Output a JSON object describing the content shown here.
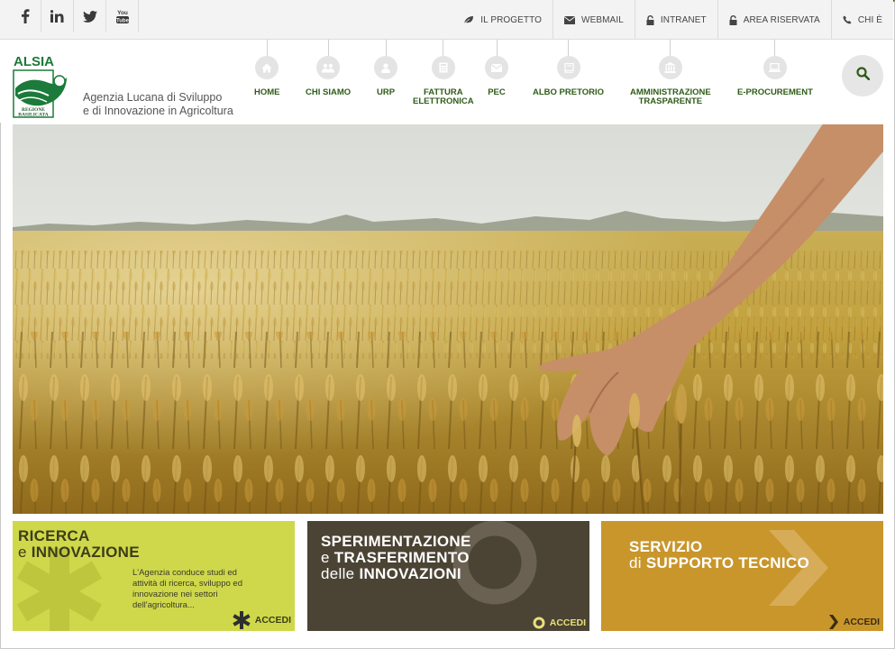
{
  "social": [
    {
      "name": "facebook-icon",
      "glyph": "f"
    },
    {
      "name": "linkedin-icon",
      "glyph": "in"
    },
    {
      "name": "twitter-icon",
      "glyph": ""
    },
    {
      "name": "youtube-icon",
      "glyph": "You Tube"
    }
  ],
  "toplinks": [
    {
      "label": "IL PROGETTO",
      "icon": "leaf-icon"
    },
    {
      "label": "WEBMAIL",
      "icon": "envelope-icon"
    },
    {
      "label": "INTRANET",
      "icon": "lock-icon"
    },
    {
      "label": "AREA RISERVATA",
      "icon": "lock-icon"
    },
    {
      "label": "CHI È",
      "icon": "phone-icon"
    }
  ],
  "logo": {
    "top_text": "ALSIA",
    "bottom_text_1": "REGIONE",
    "bottom_text_2": "BASILICATA"
  },
  "agency": {
    "line1": "Agenzia Lucana di Sviluppo",
    "line2": "e di Innovazione in Agricoltura"
  },
  "nav": [
    {
      "line1": "HOME",
      "line2": "",
      "icon": "home-icon"
    },
    {
      "line1": "CHI SIAMO",
      "line2": "",
      "icon": "users-icon"
    },
    {
      "line1": "URP",
      "line2": "",
      "icon": "user-icon"
    },
    {
      "line1": "FATTURA",
      "line2": "ELETTRONICA",
      "icon": "calculator-icon"
    },
    {
      "line1": "PEC",
      "line2": "",
      "icon": "envelope-icon"
    },
    {
      "line1": "ALBO PRETORIO",
      "line2": "",
      "icon": "book-icon"
    },
    {
      "line1": "AMMINISTRAZIONE",
      "line2": "TRASPARENTE",
      "icon": "institution-icon"
    },
    {
      "line1": "E-PROCUREMENT",
      "line2": "",
      "icon": "laptop-icon"
    }
  ],
  "cards": [
    {
      "line1_bold": "RICERCA",
      "line2_plain": "e ",
      "line2_bold": "INNOVAZIONE",
      "line3_plain": "",
      "line3_bold": "",
      "desc": "L'Agenzia conduce studi ed attività di ricerca, sviluppo ed innovazione nei settori dell'agricoltura...",
      "accedi": "ACCEDI",
      "color": "#cfd84a"
    },
    {
      "line1_bold": "SPERIMENTAZIONE",
      "line2_plain": "e ",
      "line2_bold": "TRASFERIMENTO",
      "line3_plain": "delle ",
      "line3_bold": "INNOVAZIONI",
      "desc": "",
      "accedi": "ACCEDI",
      "color": "#4b4334"
    },
    {
      "line1_bold": "SERVIZIO",
      "line2_plain": "di ",
      "line2_bold": "SUPPORTO TECNICO",
      "line3_plain": "",
      "line3_bold": "",
      "desc": "",
      "accedi": "ACCEDI",
      "color": "#c9962c"
    }
  ]
}
